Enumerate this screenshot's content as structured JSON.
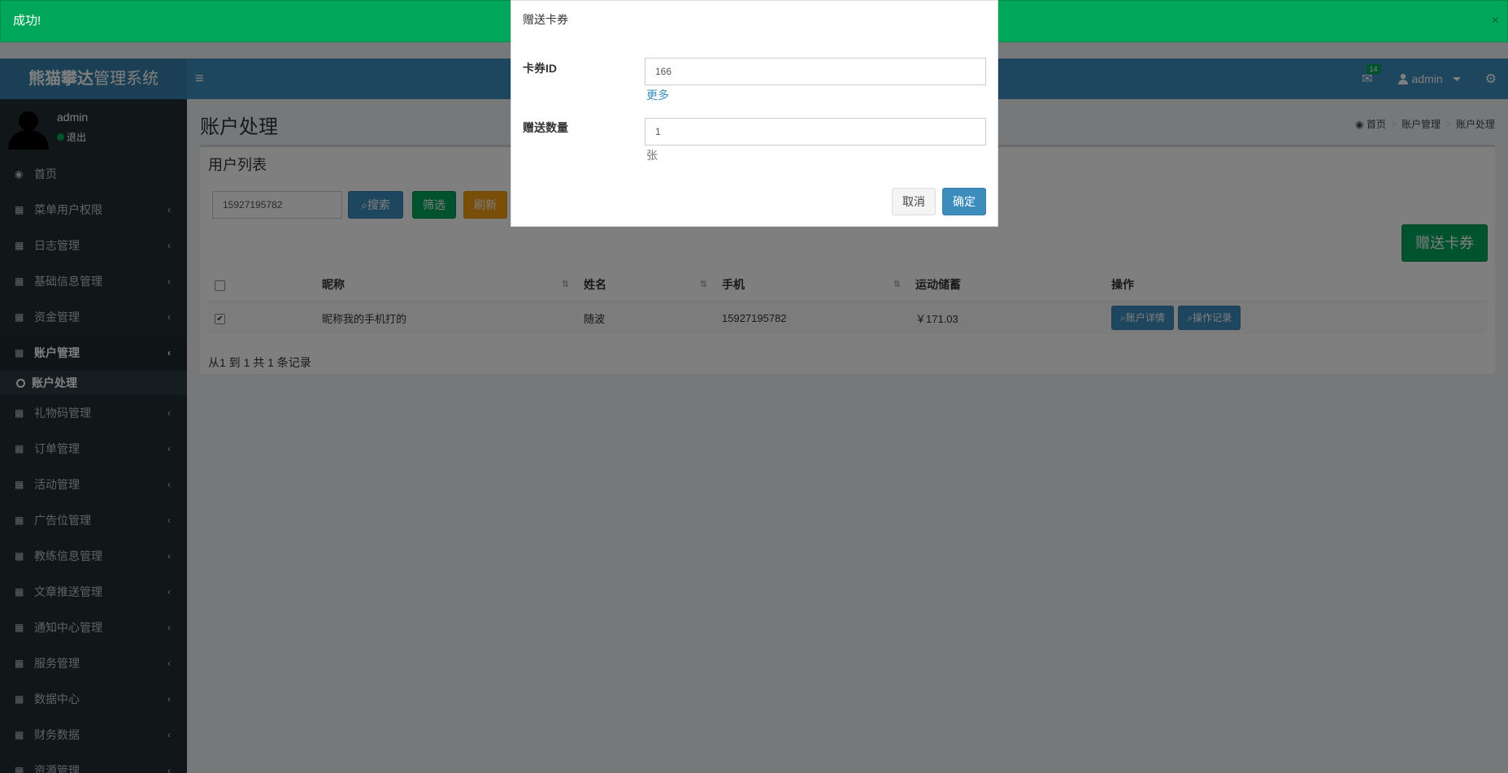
{
  "alert": {
    "message": "成功!",
    "close_glyph": "×"
  },
  "header": {
    "logo_bold": "熊猫攀达",
    "logo_rest": "管理系统",
    "menu_toggle_glyph": "≡",
    "notifications_count": "14",
    "user_name": "admin"
  },
  "sidebar": {
    "user_name": "admin",
    "user_status": "退出",
    "items": [
      {
        "label": "首页",
        "icon": "dashboard-icon"
      },
      {
        "label": "菜单用户权限",
        "icon": "table-icon"
      },
      {
        "label": "日志管理",
        "icon": "table-icon"
      },
      {
        "label": "基础信息管理",
        "icon": "table-icon"
      },
      {
        "label": "资金管理",
        "icon": "table-icon"
      },
      {
        "label": "账户管理",
        "icon": "table-icon"
      },
      {
        "label": "礼物码管理",
        "icon": "table-icon"
      },
      {
        "label": "订单管理",
        "icon": "table-icon"
      },
      {
        "label": "活动管理",
        "icon": "table-icon"
      },
      {
        "label": "广告位管理",
        "icon": "table-icon"
      },
      {
        "label": "教练信息管理",
        "icon": "table-icon"
      },
      {
        "label": "文章推送管理",
        "icon": "table-icon"
      },
      {
        "label": "通知中心管理",
        "icon": "table-icon"
      },
      {
        "label": "服务管理",
        "icon": "table-icon"
      },
      {
        "label": "数据中心",
        "icon": "table-icon"
      },
      {
        "label": "财务数据",
        "icon": "table-icon"
      },
      {
        "label": "资源管理",
        "icon": "table-icon"
      }
    ],
    "submenu_active": "账户处理"
  },
  "page": {
    "title": "账户处理",
    "breadcrumb": [
      "首页",
      "账户管理",
      "账户处理"
    ]
  },
  "box": {
    "title": "用户列表",
    "search_value": "15927195782",
    "search_btn": "搜索",
    "filter_btn": "筛选",
    "refresh_btn": "刷新",
    "gift_btn": "赠送卡券",
    "columns": [
      "昵称",
      "姓名",
      "手机",
      "运动储蓄",
      "操作"
    ],
    "rows": [
      {
        "checked": true,
        "nickname": "昵称我的手机打的",
        "name": "随波",
        "phone": "15927195782",
        "savings": "￥171.03",
        "actions": [
          "账户详情",
          "操作记录"
        ]
      }
    ],
    "footer": "从1 到 1 共 1 条记录"
  },
  "modal": {
    "title": "赠送卡券",
    "card_id_label": "卡券ID",
    "card_id_value": "166",
    "more_link": "更多",
    "quantity_label": "赠送数量",
    "quantity_value": "1",
    "quantity_unit": "张",
    "cancel_btn": "取消",
    "confirm_btn": "确定"
  },
  "colors": {
    "header": "#3c8dbc",
    "sidebar": "#222d32",
    "success": "#00a65a",
    "warning": "#f39c12",
    "primary": "#3c8dbc"
  }
}
